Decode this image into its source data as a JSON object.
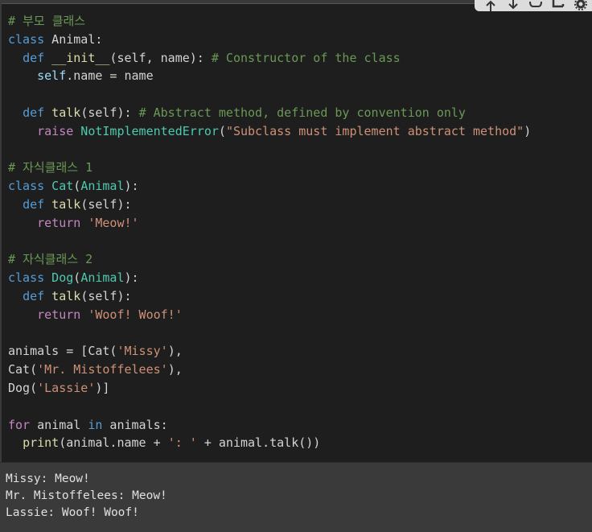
{
  "toolbar": {
    "icons": [
      "move-up-icon",
      "move-down-icon",
      "link-icon",
      "comment-icon",
      "settings-icon"
    ]
  },
  "code": {
    "l1_comment": "# 부모 클래스",
    "l2_kw": "class",
    "l2_name": " Animal:",
    "l3_indent": "  ",
    "l3_kw": "def",
    "l3_fn": " __init__",
    "l3_args": "(self, name): ",
    "l3_comment": "# Constructor of the class",
    "l4_indent": "    ",
    "l4_self": "self",
    "l4_rest": ".name = name",
    "l5": "",
    "l6_indent": "  ",
    "l6_kw": "def",
    "l6_fn": " talk",
    "l6_args": "(self): ",
    "l6_comment": "# Abstract method, defined by convention only",
    "l7_indent": "    ",
    "l7_kw": "raise",
    "l7_cls": " NotImplementedError",
    "l7_p1": "(",
    "l7_str": "\"Subclass must implement abstract method\"",
    "l7_p2": ")",
    "l8": "",
    "l9_comment": "# 자식클래스 1",
    "l10_kw": "class",
    "l10_cls": " Cat",
    "l10_p1": "(",
    "l10_base": "Animal",
    "l10_p2": "):",
    "l11_indent": "  ",
    "l11_kw": "def",
    "l11_fn": " talk",
    "l11_args": "(self):",
    "l12_indent": "    ",
    "l12_kw": "return",
    "l12_str": " 'Meow!'",
    "l13": "",
    "l14_comment": "# 자식클래스 2",
    "l15_kw": "class",
    "l15_cls": " Dog",
    "l15_p1": "(",
    "l15_base": "Animal",
    "l15_p2": "):",
    "l16_indent": "  ",
    "l16_kw": "def",
    "l16_fn": " talk",
    "l16_args": "(self):",
    "l17_indent": "    ",
    "l17_kw": "return",
    "l17_str": " 'Woof! Woof!'",
    "l18": "",
    "l19_a": "animals = [Cat(",
    "l19_str": "'Missy'",
    "l19_b": "),",
    "l20_a": "Cat(",
    "l20_str": "'Mr. Mistoffelees'",
    "l20_b": "),",
    "l21_a": "Dog(",
    "l21_str": "'Lassie'",
    "l21_b": ")]",
    "l22": "",
    "l23_kw": "for",
    "l23_a": " animal ",
    "l23_kw2": "in",
    "l23_b": " animals:",
    "l24_indent": "  ",
    "l24_fn": "print",
    "l24_a": "(animal.name + ",
    "l24_str": "': '",
    "l24_b": " + animal.talk())"
  },
  "output": {
    "lines": [
      "Missy: Meow!",
      "Mr. Mistoffelees: Meow!",
      "Lassie: Woof! Woof!"
    ]
  }
}
